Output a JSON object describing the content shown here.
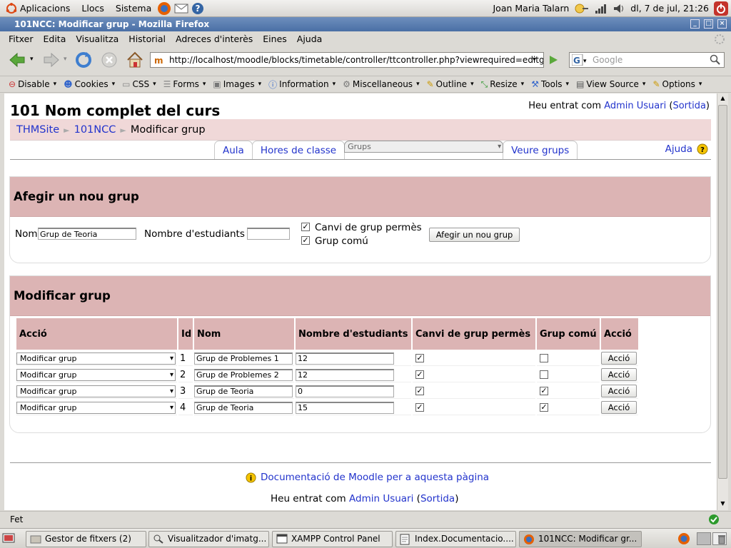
{
  "top_panel": {
    "menus": [
      "Aplicacions",
      "Llocs",
      "Sistema"
    ],
    "user": "Joan Maria Talarn",
    "clock": "dl,  7 de jul, 21:26"
  },
  "window": {
    "title": "101NCC: Modificar grup - Mozilla Firefox"
  },
  "menubar": [
    "Fitxer",
    "Edita",
    "Visualitza",
    "Historial",
    "Adreces d'interès",
    "Eines",
    "Ajuda"
  ],
  "nav": {
    "url": "http://localhost/moodle/blocks/timetable/controller/ttcontroller.php?viewrequired=editgro",
    "search_placeholder": "Google"
  },
  "webdev_toolbar": [
    "Disable",
    "Cookies",
    "CSS",
    "Forms",
    "Images",
    "Information",
    "Miscellaneous",
    "Outline",
    "Resize",
    "Tools",
    "View Source",
    "Options"
  ],
  "page": {
    "title": "101 Nom complet del curs",
    "login_prefix": "Heu entrat com",
    "login_user": "Admin Usuari",
    "logout": "Sortida",
    "breadcrumb": [
      "THMSite",
      "101NCC",
      "Modificar grup"
    ],
    "tabs": [
      "Aula",
      "Hores de classe",
      "Grups",
      "Veure grups"
    ],
    "selected_tab": "Grups",
    "help": "Ajuda"
  },
  "add_group": {
    "heading": "Afegir un nou grup",
    "name_label": "Nom",
    "name_value": "Grup de Teoria",
    "students_label": "Nombre d'estudiants",
    "students_value": "",
    "check1_label": "Canvi de grup permès",
    "check1_checked": true,
    "check2_label": "Grup comú",
    "check2_checked": true,
    "button": "Afegir un nou grup"
  },
  "modify_group": {
    "heading": "Modificar grup",
    "columns": [
      "Acció",
      "Id",
      "Nom",
      "Nombre d'estudiants",
      "Canvi de grup permès",
      "Grup comú",
      "Acció"
    ],
    "rows": [
      {
        "action": "Modificar grup",
        "id": "1",
        "name": "Grup de Problemes 1",
        "students": "12",
        "change_allowed": true,
        "common": false,
        "button": "Acció"
      },
      {
        "action": "Modificar grup",
        "id": "2",
        "name": "Grup de Problemes 2",
        "students": "12",
        "change_allowed": true,
        "common": false,
        "button": "Acció"
      },
      {
        "action": "Modificar grup",
        "id": "3",
        "name": "Grup de Teoria",
        "students": "0",
        "change_allowed": true,
        "common": true,
        "button": "Acció"
      },
      {
        "action": "Modificar grup",
        "id": "4",
        "name": "Grup de Teoria",
        "students": "15",
        "change_allowed": true,
        "common": true,
        "button": "Acció"
      }
    ]
  },
  "footer": {
    "doc_link": "Documentació de Moodle per a aquesta pàgina",
    "login_prefix": "Heu entrat com",
    "login_user": "Admin Usuari",
    "logout": "Sortida"
  },
  "status": "Fet",
  "taskbar": [
    "Gestor de fitxers (2)",
    "Visualitzador d'imatg...",
    "XAMPP Control Panel",
    "Index.Documentacio....",
    "101NCC: Modificar gr..."
  ]
}
